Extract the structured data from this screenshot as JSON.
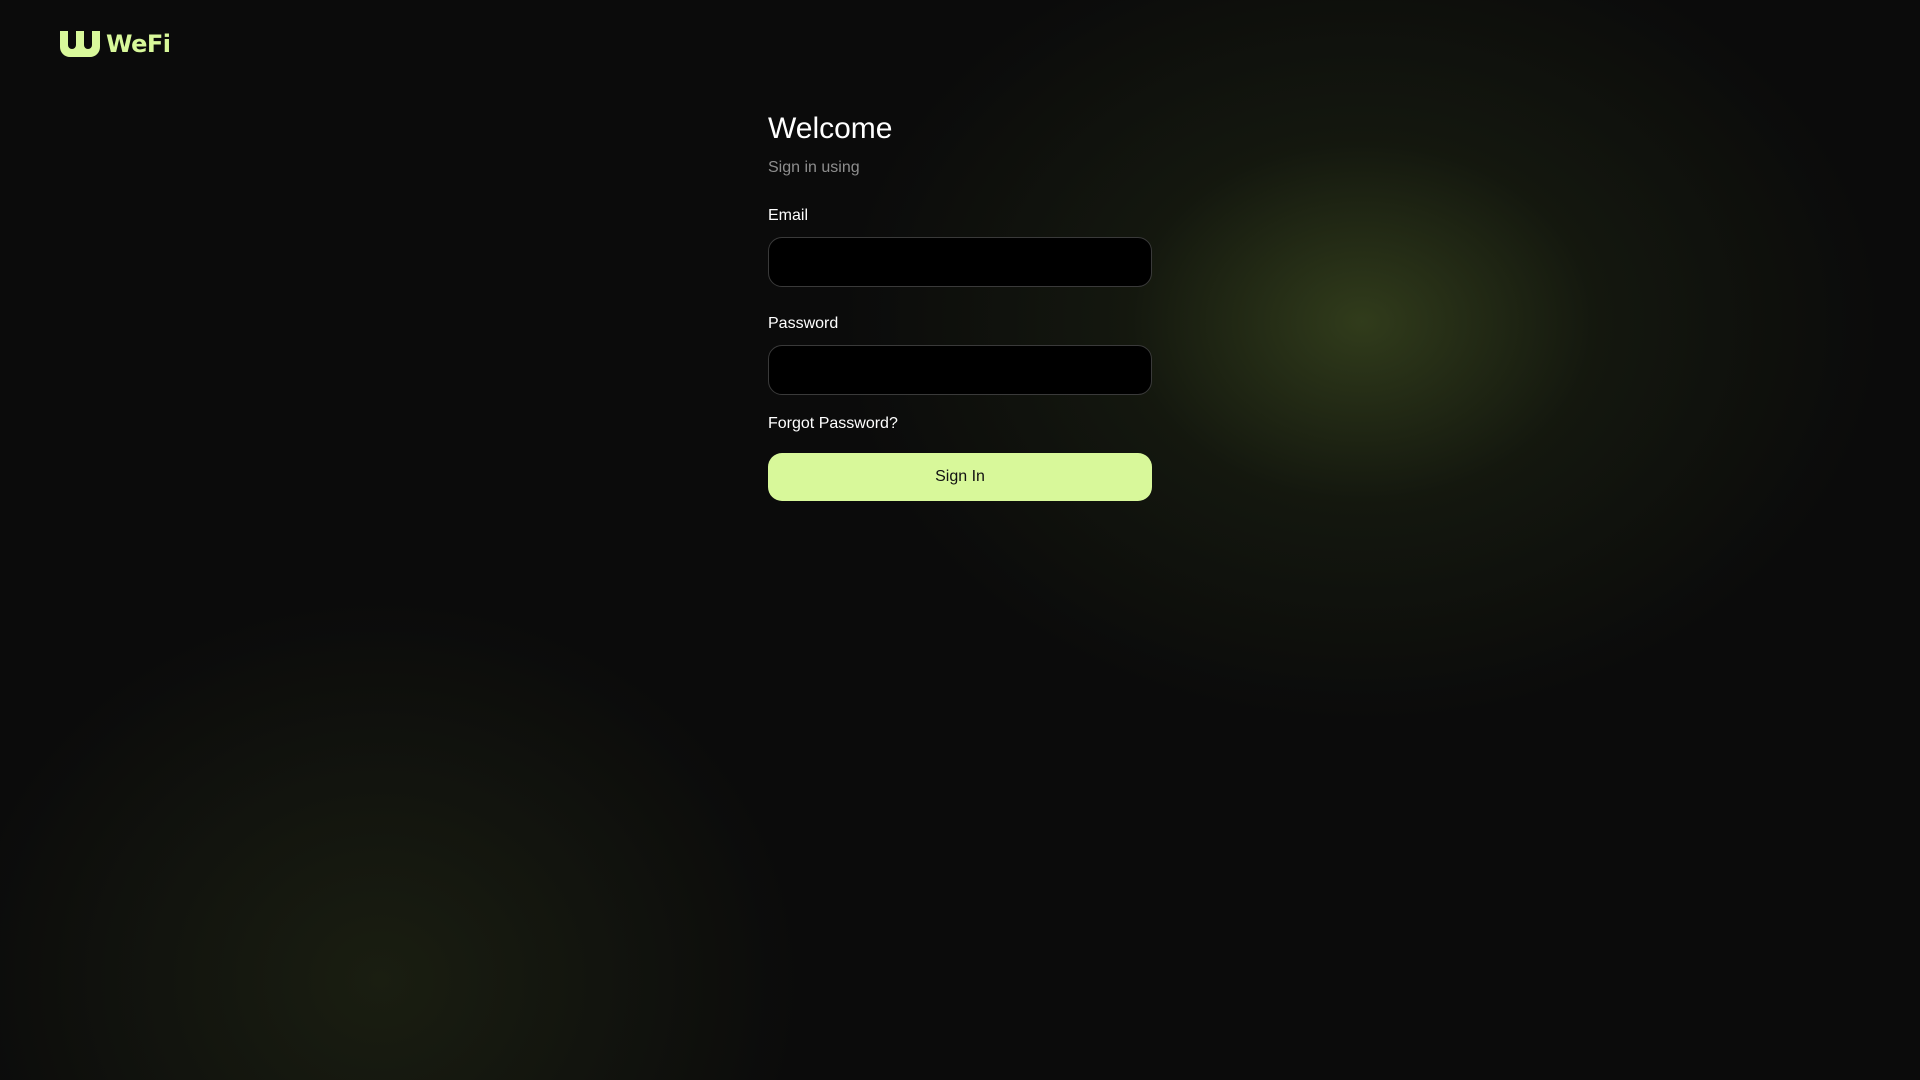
{
  "brand": {
    "name": "WeFi",
    "color": "#d8f89a",
    "icon": "wefi-logo-icon"
  },
  "login": {
    "title": "Welcome",
    "subtitle": "Sign in using",
    "email": {
      "label": "Email",
      "value": "",
      "placeholder": ""
    },
    "password": {
      "label": "Password",
      "value": "",
      "placeholder": ""
    },
    "forgot_password": "Forgot Password?",
    "submit_label": "Sign In"
  },
  "colors": {
    "background": "#0b0b0b",
    "accent": "#d8f89a",
    "muted_text": "#8e8e8e"
  }
}
